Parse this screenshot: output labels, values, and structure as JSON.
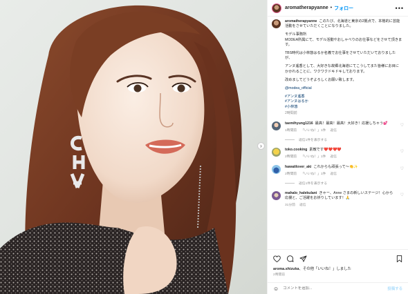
{
  "post": {
    "username": "aromatherapyanne",
    "follow_label": "フォロー",
    "separator": "•",
    "more_icon": "more-horizontal-icon"
  },
  "caption": {
    "username": "aromatherapyanne",
    "paragraphs": [
      "このたび、北海道と東京の2拠点で、本格的に芸能活動をさせていただくことになりました。",
      "モデル事務所\nMODEA所属にて、モデル活動やおしゃべりのお仕事などをさせて頂きます。",
      "TBS時代は小林悠はるか名義でお仕事をさせていただいておりましたが、",
      "アンヌ遙香として、大好きな故郷北海道にてこうしてまた皆様にお目にかかれることに、ワクワクドキドキしております。",
      "改めましてどうぞよろしくお願い致します。"
    ],
    "mention": "@modea_official",
    "tags": [
      "#アンヌ遙香",
      "#アンヌはるか",
      "#小林悠"
    ],
    "time": "2時間前"
  },
  "comments": [
    {
      "username": "taemihyung1216",
      "text": "最高！最高！最高！大好き！応援しちゃう💕",
      "time": "1時間前",
      "likes": "「いいね！」1件",
      "reply": "返信",
      "replies_label": "返信1件を表示する"
    },
    {
      "username": "toko.cooking",
      "text": "素敵です❤️❤️❤️❤️",
      "time": "2時間前",
      "likes": "「いいね！」1件",
      "reply": "返信",
      "replies_label": ""
    },
    {
      "username": "hawaiilover_aki",
      "text": "これからも頑張って〜👏✨",
      "time": "2時間前",
      "likes": "「いいね！」1件",
      "reply": "返信",
      "replies_label": "返信1件を表示する"
    },
    {
      "username": "mahalo_halekulani",
      "text": "きゃー、Anne さまの新しいステージ！心から応援と、ご活躍をお祈りしています！🙏",
      "time": "31分前",
      "likes": "",
      "reply": "返信",
      "replies_label": ""
    }
  ],
  "footer": {
    "liked_user": "aroma.shizuka",
    "liked_by_text": "、その他「いいね！」しました",
    "others_label": "その他",
    "date": "2時間前",
    "comment_placeholder": "コメントを追加...",
    "post_label": "投稿する"
  },
  "colors": {
    "accent": "#0095f6",
    "link": "#00376b",
    "muted": "#8e8e8e"
  }
}
